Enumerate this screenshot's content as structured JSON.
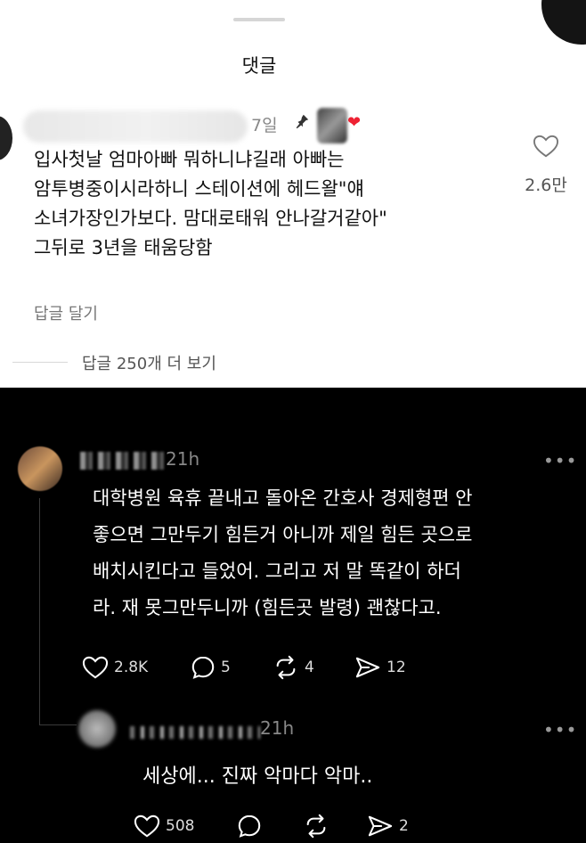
{
  "sheet": {
    "title": "댓글",
    "comment": {
      "time": "7일",
      "pin_icon": "✦",
      "lines": [
        "입사첫날 엄마아빠 뭐하니냐길래 아빠는",
        "암투병중이시라하니 스테이션에 헤드왈\"얘",
        "소녀가장인가보다. 맘대로태워 안나갈거같아\"",
        "그뒤로 3년을 태움당함"
      ],
      "like_count": "2.6만",
      "reply_label": "답글 달기",
      "more_replies": "답글 250개 더 보기"
    }
  },
  "thread": {
    "post": {
      "time": "21h",
      "lines": [
        "대학병원 육휴 끝내고 돌아온 간호사 경제형편 안",
        "좋으면 그만두기 힘든거 아니까 제일 힘든 곳으로",
        "배치시킨다고 들었어. 그리고 저 말 똑같이 하더",
        "라. 재 못그만두니까 (힘든곳 발령) 괜찮다고."
      ],
      "likes": "2.8K",
      "comments": "5",
      "reposts": "4",
      "shares": "12",
      "more": "•••"
    },
    "reply": {
      "time": "21h",
      "text": "세상에... 진짜 악마다 악마..",
      "likes": "508",
      "shares": "2",
      "more": "•••"
    }
  }
}
